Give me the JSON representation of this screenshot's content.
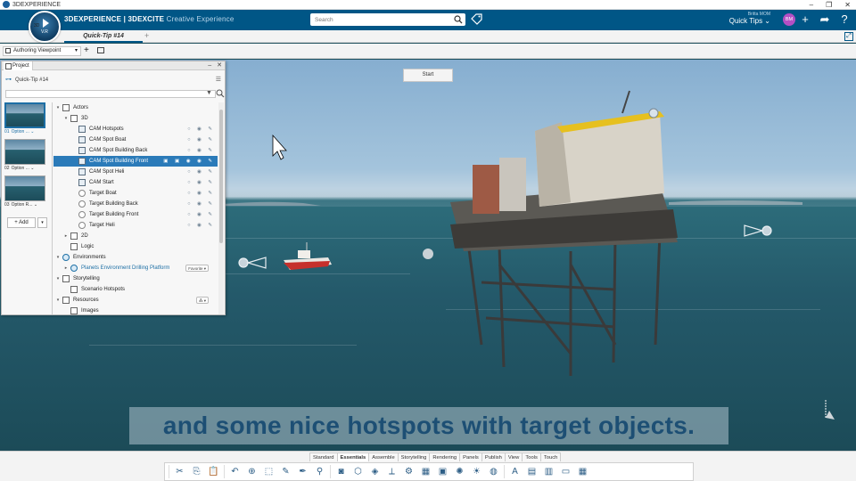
{
  "window": {
    "title": "3DEXPERIENCE"
  },
  "header": {
    "brand_bold": "3DEXPERIENCE | 3DEXCITE",
    "brand_sub": "Creative Experience",
    "compass_label": "3D",
    "compass_version": "V.R",
    "search_placeholder": "Search",
    "user_name": "Britta MOM",
    "workspace": "Quick Tips"
  },
  "tabs": [
    {
      "label": "Quick-Tip #14",
      "active": true
    }
  ],
  "viewpoint": {
    "selected": "Authoring Viewpoint"
  },
  "viewport": {
    "start_label": "Start",
    "caption": "and some nice hotspots with target objects."
  },
  "panel": {
    "tab_label": "Project",
    "project_name": "Quick-Tip #14",
    "add_label": "+ Add",
    "thumbnails": [
      {
        "num": "01",
        "label": "Option ...",
        "active": true
      },
      {
        "num": "02",
        "label": "Option ...",
        "active": false
      },
      {
        "num": "03",
        "label": "Option R...",
        "active": false
      }
    ],
    "tree": [
      {
        "label": "Actors",
        "level": 0,
        "exp": "▾",
        "icon": "box"
      },
      {
        "label": "3D",
        "level": 1,
        "exp": "▾",
        "icon": "box"
      },
      {
        "label": "CAM Hotspots",
        "level": 2,
        "icon": "cam",
        "acts": "○ ◉ ✎"
      },
      {
        "label": "CAM Spot Boat",
        "level": 2,
        "icon": "cam",
        "acts": "○ ◉ ✎"
      },
      {
        "label": "CAM Spot Building Back",
        "level": 2,
        "icon": "cam",
        "acts": "○ ◉ ✎"
      },
      {
        "label": "CAM Spot Building Front",
        "level": 2,
        "icon": "cam",
        "acts": "▣ ▣ ◉ ◉ ✎",
        "selected": true
      },
      {
        "label": "CAM Spot Heli",
        "level": 2,
        "icon": "cam",
        "acts": "○ ◉ ✎"
      },
      {
        "label": "CAM Start",
        "level": 2,
        "icon": "cam",
        "acts": "○ ◉ ✎"
      },
      {
        "label": "Target Boat",
        "level": 2,
        "icon": "tgt",
        "acts": "○ ◉ ✎"
      },
      {
        "label": "Target Building Back",
        "level": 2,
        "icon": "tgt",
        "acts": "○ ◉ ✎"
      },
      {
        "label": "Target Building Front",
        "level": 2,
        "icon": "tgt",
        "acts": "○ ◉ ✎"
      },
      {
        "label": "Target Heli",
        "level": 2,
        "icon": "tgt",
        "acts": "○ ◉ ✎"
      },
      {
        "label": "2D",
        "level": 1,
        "exp": "▸",
        "icon": "box"
      },
      {
        "label": "Logic",
        "level": 1,
        "icon": "box"
      },
      {
        "label": "Environments",
        "level": 0,
        "exp": "▾",
        "icon": "env"
      },
      {
        "label": "Planets Environment Drilling Platform",
        "level": 1,
        "exp": "▸",
        "icon": "env",
        "link": true,
        "chip": "Favorite ▾"
      },
      {
        "label": "Storytelling",
        "level": 0,
        "exp": "▾",
        "icon": "box"
      },
      {
        "label": "Scenario Hotspots",
        "level": 1,
        "icon": "box"
      },
      {
        "label": "Resources",
        "level": 0,
        "exp": "▾",
        "icon": "box",
        "chip": "⁂ ▾"
      },
      {
        "label": "Images",
        "level": 1,
        "icon": "box"
      }
    ]
  },
  "bottom_tabs": [
    "Standard",
    "Essentials",
    "Assemble",
    "Storytelling",
    "Rendering",
    "Panels",
    "Publish",
    "View",
    "Tools",
    "Touch"
  ],
  "bottom_active": "Essentials",
  "bottom_icons": [
    "scissors-icon",
    "copy-icon",
    "paste-icon",
    "undo-icon",
    "zoom-fit-icon",
    "select-icon",
    "edit-icon",
    "pen-icon",
    "search-icon",
    "camera-icon",
    "shape-icon",
    "cube-icon",
    "axis-icon",
    "joint-icon",
    "material-icon",
    "render-icon",
    "color-wheel-icon",
    "light-icon",
    "sphere-icon",
    "text-icon",
    "media-icon",
    "panel-icon",
    "window-icon",
    "table-icon"
  ],
  "colors": {
    "brand": "#005686",
    "accent": "#2b7bb9",
    "sea": "#24596a",
    "sky": "#a4c4dc"
  }
}
